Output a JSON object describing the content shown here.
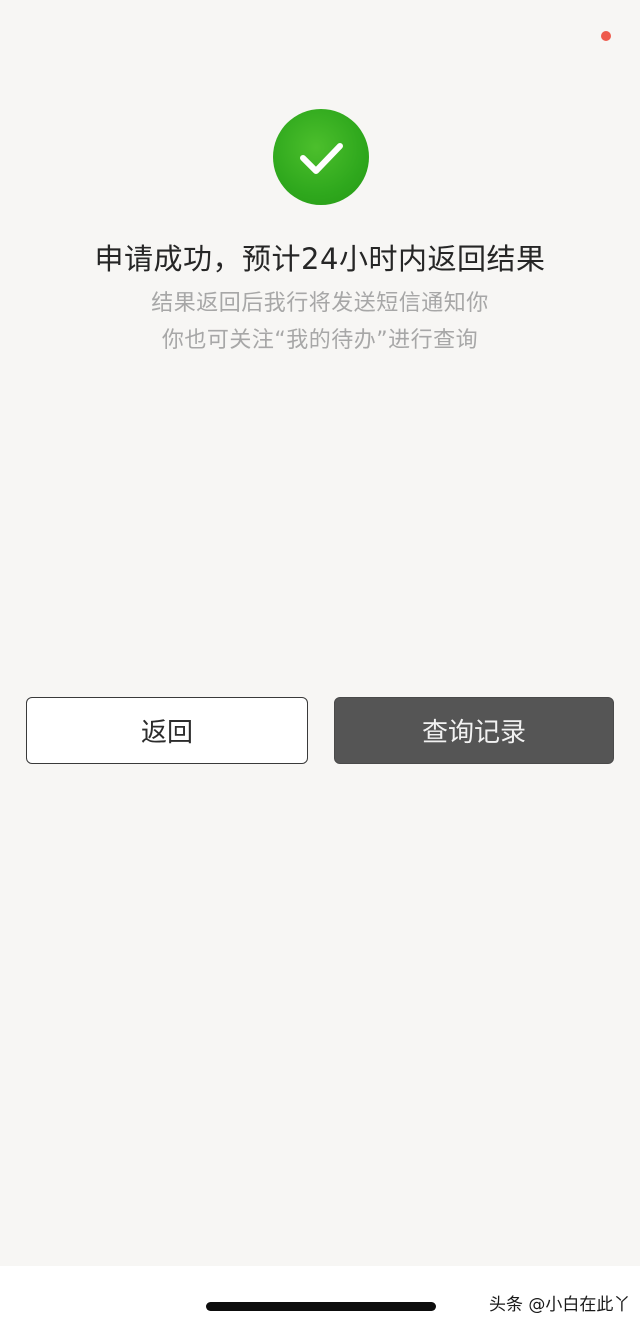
{
  "status": {
    "headline": "申请成功，预计24小时内返回结果",
    "line1": "结果返回后我行将发送短信通知你",
    "line2": "你也可关注“我的待办”进行查询"
  },
  "icons": {
    "success": "check-circle-icon"
  },
  "buttons": {
    "back_label": "返回",
    "query_label": "查询记录"
  },
  "watermark": "头条 @小白在此丫",
  "colors": {
    "success_green": "#2fa81d",
    "notification_dot": "#ee5a4c",
    "primary_button": "#555555",
    "background": "#f7f6f4"
  }
}
